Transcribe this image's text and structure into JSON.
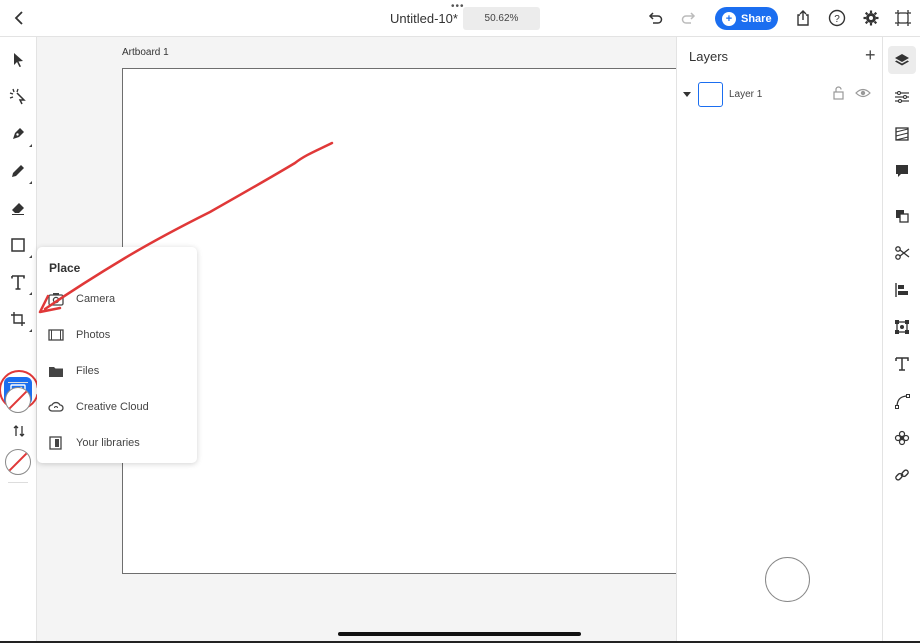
{
  "topbar": {
    "doc_title": "Untitled-10*",
    "zoom": "50.62%",
    "share_label": "Share"
  },
  "canvas": {
    "artboard_label": "Artboard 1"
  },
  "place_menu": {
    "title": "Place",
    "items": [
      {
        "label": "Camera",
        "icon": "camera-icon"
      },
      {
        "label": "Photos",
        "icon": "photos-icon"
      },
      {
        "label": "Files",
        "icon": "folder-icon"
      },
      {
        "label": "Creative Cloud",
        "icon": "creative-cloud-icon"
      },
      {
        "label": "Your libraries",
        "icon": "libraries-icon"
      }
    ]
  },
  "layers": {
    "title": "Layers",
    "items": [
      {
        "name": "Layer 1"
      }
    ]
  },
  "colors": {
    "accent": "#1b6ef0",
    "annotation": "#e03838"
  }
}
